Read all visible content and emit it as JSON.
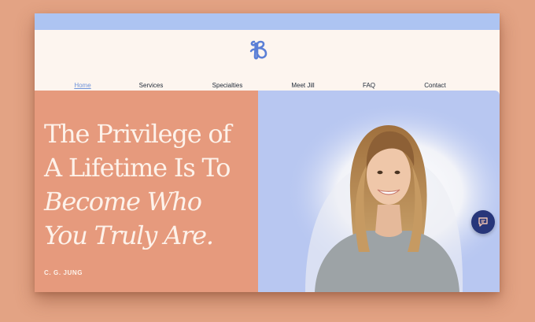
{
  "brand": {
    "logo_icon": "script-b-logo-icon",
    "logo_color": "#5b7fd6"
  },
  "nav": {
    "items": [
      {
        "label": "Home",
        "active": true
      },
      {
        "label": "Services"
      },
      {
        "label": "Specialties"
      },
      {
        "label": "Meet Jill"
      },
      {
        "label": "FAQ"
      },
      {
        "label": "Contact"
      }
    ]
  },
  "hero": {
    "quote_lines": [
      {
        "text": "The Privilege of",
        "italic": false
      },
      {
        "text": "A Lifetime Is To",
        "italic": false
      },
      {
        "text": "Become Who",
        "italic": true
      },
      {
        "text": "You Truly Are.",
        "italic": true
      }
    ],
    "author": "C. G. JUNG",
    "photo_icon": "portrait-photo",
    "chat_icon": "chat-icon"
  },
  "colors": {
    "background": "#e3a384",
    "hero_left": "#e69a7d",
    "hero_right": "#b8c7f1",
    "topbar": "#adc4f2",
    "header": "#fdf5ef",
    "chat_button": "#27367a"
  }
}
